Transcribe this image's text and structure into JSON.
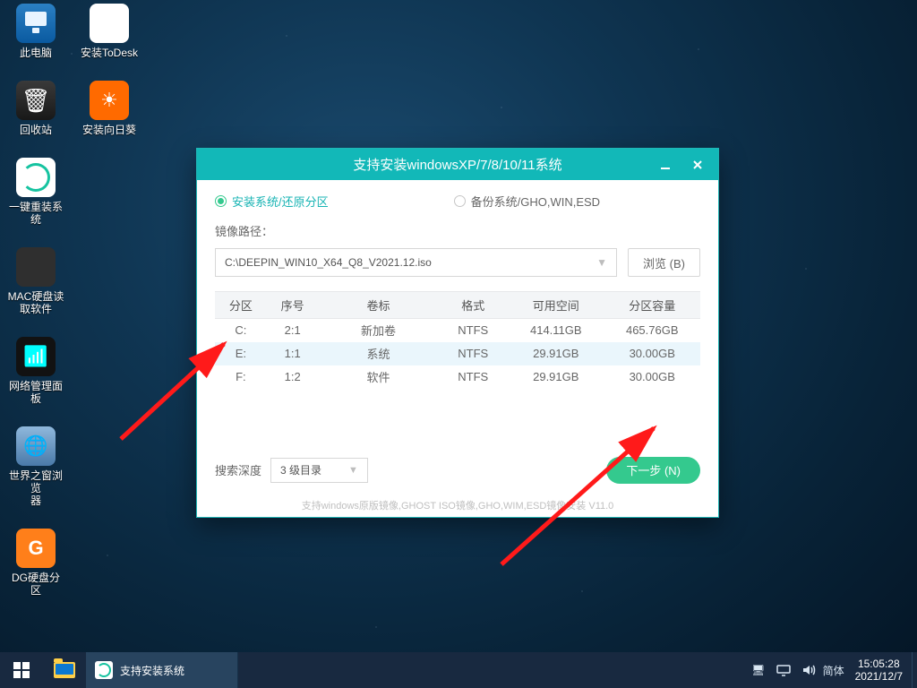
{
  "desktop": {
    "icons": [
      {
        "label": "此电脑"
      },
      {
        "label": "安装ToDesk"
      },
      {
        "label": "回收站"
      },
      {
        "label": "安装向日葵"
      },
      {
        "label": "一键重装系统"
      },
      {
        "label": "MAC硬盘读\n取软件"
      },
      {
        "label": "网络管理面板"
      },
      {
        "label": "世界之窗浏览\n器"
      },
      {
        "label": "DG硬盘分区"
      }
    ]
  },
  "window": {
    "title": "支持安装windowsXP/7/8/10/11系统",
    "tab_install": "安装系统/还原分区",
    "tab_backup": "备份系统/GHO,WIN,ESD",
    "path_label": "镜像路径：",
    "path_value": "C:\\DEEPIN_WIN10_X64_Q8_V2021.12.iso",
    "browse": "浏览 (B)",
    "search_depth_label": "搜索深度",
    "search_depth_value": "3 级目录",
    "next": "下一步 (N)",
    "footer": "支持windows原版镜像,GHOST ISO镜像,GHO,WIM,ESD镜像安装 V11.0",
    "cols": {
      "partition": "分区",
      "index": "序号",
      "volume": "卷标",
      "format": "格式",
      "free": "可用空间",
      "size": "分区容量"
    },
    "rows": [
      {
        "partition": "C:",
        "index": "2:1",
        "volume": "新加卷",
        "format": "NTFS",
        "free": "414.11GB",
        "size": "465.76GB",
        "selected": false
      },
      {
        "partition": "E:",
        "index": "1:1",
        "volume": "系统",
        "format": "NTFS",
        "free": "29.91GB",
        "size": "30.00GB",
        "selected": true
      },
      {
        "partition": "F:",
        "index": "1:2",
        "volume": "软件",
        "format": "NTFS",
        "free": "29.91GB",
        "size": "30.00GB",
        "selected": false
      }
    ]
  },
  "taskbar": {
    "task_label": "支持安装系统",
    "ime": "简体",
    "time": "15:05:28",
    "date": "2021/12/7"
  }
}
